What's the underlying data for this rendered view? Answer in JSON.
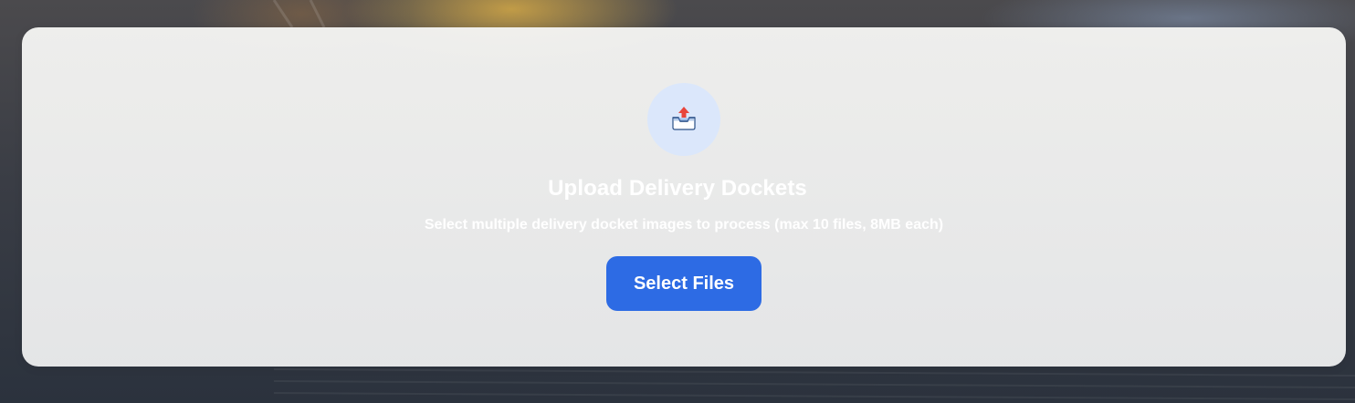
{
  "upload": {
    "icon": "inbox-upload-icon",
    "title": "Upload Delivery Dockets",
    "subtitle": "Select multiple delivery docket images to process (max 10 files, 8MB each)",
    "button_label": "Select Files"
  },
  "colors": {
    "accent": "#2d6be4",
    "icon_bg": "#dbe7fb",
    "card_bg": "#efefef",
    "text": "#ffffff"
  }
}
